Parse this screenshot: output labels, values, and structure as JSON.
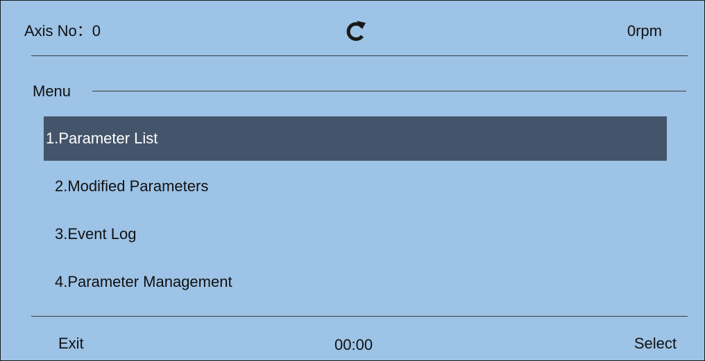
{
  "status": {
    "axis_label": "Axis No：0",
    "rotation_icon": "rotate-clockwise-icon",
    "speed": "0rpm"
  },
  "menu": {
    "title": "Menu",
    "selected_index": 0,
    "items": [
      {
        "label": "1.Parameter List"
      },
      {
        "label": "2.Modified Parameters"
      },
      {
        "label": "3.Event Log"
      },
      {
        "label": "4.Parameter Management"
      }
    ]
  },
  "footer": {
    "exit_label": "Exit",
    "timer": "00:00",
    "select_label": "Select"
  },
  "colors": {
    "background": "#9dc3e6",
    "selected_row": "#44546a",
    "selected_text": "#ffffff",
    "text": "#111111"
  }
}
